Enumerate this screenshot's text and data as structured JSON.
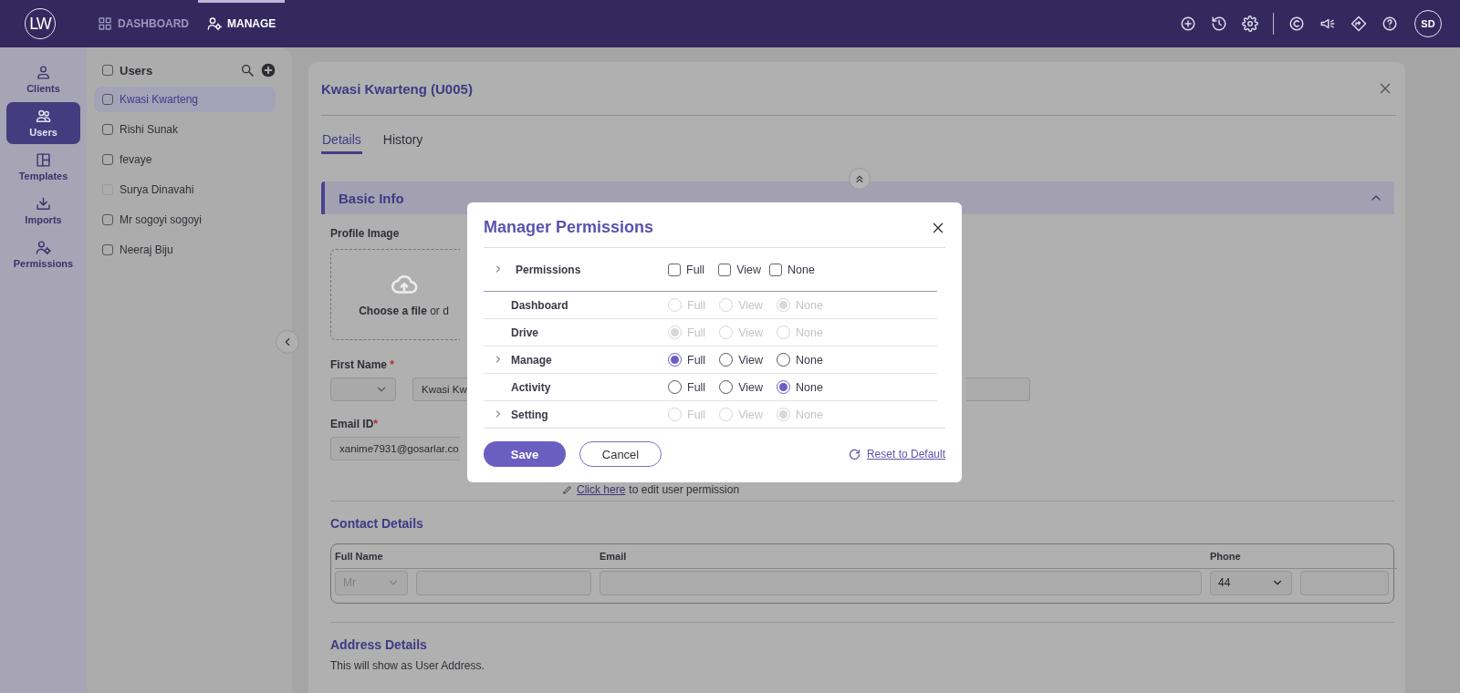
{
  "topbar": {
    "logo": "LW",
    "nav": [
      {
        "label": "DASHBOARD",
        "selected": false
      },
      {
        "label": "MANAGE",
        "selected": true
      }
    ],
    "avatar": "SD"
  },
  "sidebar": {
    "items": [
      {
        "label": "Clients",
        "selected": false
      },
      {
        "label": "Users",
        "selected": true
      },
      {
        "label": "Templates",
        "selected": false
      },
      {
        "label": "Imports",
        "selected": false
      },
      {
        "label": "Permissions",
        "selected": false
      }
    ]
  },
  "user_list": {
    "title": "Users",
    "checked": false,
    "users": [
      {
        "name": "Kwasi Kwarteng",
        "selected": true,
        "disabled": false
      },
      {
        "name": "Rishi Sunak",
        "selected": false,
        "disabled": false
      },
      {
        "name": "fevaye",
        "selected": false,
        "disabled": false
      },
      {
        "name": "Surya Dinavahi",
        "selected": false,
        "disabled": true
      },
      {
        "name": "Mr sogoyi sogoyi",
        "selected": false,
        "disabled": false
      },
      {
        "name": "Neeraj Biju",
        "selected": false,
        "disabled": false
      }
    ]
  },
  "detail": {
    "title": "Kwasi Kwarteng (U005)",
    "tabs": [
      {
        "label": "Details",
        "selected": true
      },
      {
        "label": "History",
        "selected": false
      }
    ],
    "section": {
      "title": "Basic Info",
      "expanded": true
    },
    "profile_image_label": "Profile Image",
    "upload_text": "**Choose a file** or d",
    "first_name": {
      "label": "First Name",
      "mark": "*",
      "value": "Kwasi Kw"
    },
    "email": {
      "label": "Email ID",
      "mark": "*",
      "value": "xanime7931@gosarlar.co"
    },
    "permission_link": "Click here",
    "permission_text": "to edit user permission",
    "contact": {
      "title": "Contact Details",
      "columns": [
        "Full Name",
        "Email",
        "Phone"
      ],
      "salutation": "Mr",
      "phone_code": "44"
    },
    "address": {
      "title": "Address Details",
      "note": "This will show as User Address."
    }
  },
  "modal": {
    "title": "Manager Permissions",
    "header_row": {
      "label": "Permissions",
      "expandable": true,
      "options": [
        {
          "label": "Full",
          "checked": false
        },
        {
          "label": "View",
          "checked": false
        },
        {
          "label": "None",
          "checked": false
        }
      ]
    },
    "rows": [
      {
        "label": "Dashboard",
        "expandable": false,
        "disabled": true,
        "options": [
          {
            "label": "Full",
            "selected": false
          },
          {
            "label": "View",
            "selected": false
          },
          {
            "label": "None",
            "selected": true
          }
        ]
      },
      {
        "label": "Drive",
        "expandable": false,
        "disabled": true,
        "options": [
          {
            "label": "Full",
            "selected": true
          },
          {
            "label": "View",
            "selected": false
          },
          {
            "label": "None",
            "selected": false
          }
        ]
      },
      {
        "label": "Manage",
        "expandable": true,
        "disabled": false,
        "options": [
          {
            "label": "Full",
            "selected": true
          },
          {
            "label": "View",
            "selected": false
          },
          {
            "label": "None",
            "selected": false
          }
        ]
      },
      {
        "label": "Activity",
        "expandable": false,
        "disabled": false,
        "options": [
          {
            "label": "Full",
            "selected": false
          },
          {
            "label": "View",
            "selected": false
          },
          {
            "label": "None",
            "selected": true
          }
        ]
      },
      {
        "label": "Setting",
        "expandable": true,
        "disabled": true,
        "options": [
          {
            "label": "Full",
            "selected": false
          },
          {
            "label": "View",
            "selected": false
          },
          {
            "label": "None",
            "selected": true
          }
        ]
      }
    ],
    "buttons": [
      {
        "label": "Save",
        "kind": "primary"
      },
      {
        "label": "Cancel",
        "kind": "secondary"
      }
    ],
    "reset_link": "Reset to Default"
  }
}
